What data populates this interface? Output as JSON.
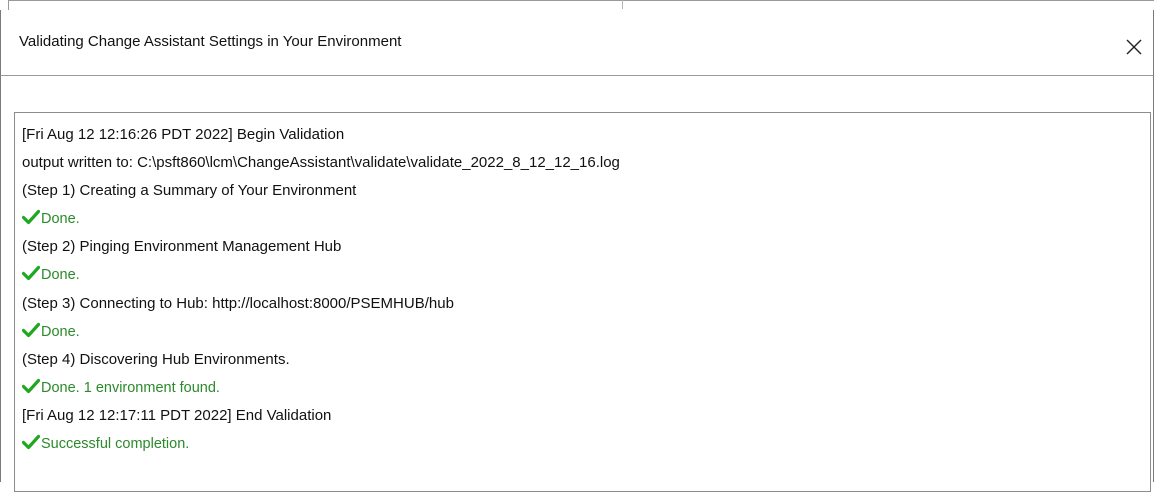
{
  "dialog": {
    "title": "Validating Change Assistant Settings in Your Environment",
    "close_icon": "close-icon"
  },
  "log": {
    "lines": [
      {
        "type": "info",
        "text": "[Fri Aug 12 12:16:26 PDT 2022] Begin Validation"
      },
      {
        "type": "info",
        "text": "output written to: C:\\psft860\\lcm\\ChangeAssistant\\validate\\validate_2022_8_12_12_16.log"
      },
      {
        "type": "info",
        "text": "(Step 1) Creating a Summary of Your Environment"
      },
      {
        "type": "success",
        "text": "Done."
      },
      {
        "type": "info",
        "text": "(Step 2) Pinging Environment Management Hub"
      },
      {
        "type": "success",
        "text": "Done."
      },
      {
        "type": "info",
        "text": "(Step 3) Connecting to Hub: http://localhost:8000/PSEMHUB/hub"
      },
      {
        "type": "success",
        "text": "Done."
      },
      {
        "type": "info",
        "text": "(Step 4) Discovering Hub Environments."
      },
      {
        "type": "success",
        "text": "Done.  1 environment found."
      },
      {
        "type": "info",
        "text": "[Fri Aug 12 12:17:11 PDT 2022] End Validation"
      },
      {
        "type": "success",
        "text": "Successful completion."
      }
    ]
  },
  "colors": {
    "success_text": "#2b8a2b",
    "check_mark": "#1fa81f",
    "text": "#111111",
    "border": "#8c8c8c"
  },
  "icons": {
    "success": "check-icon"
  }
}
